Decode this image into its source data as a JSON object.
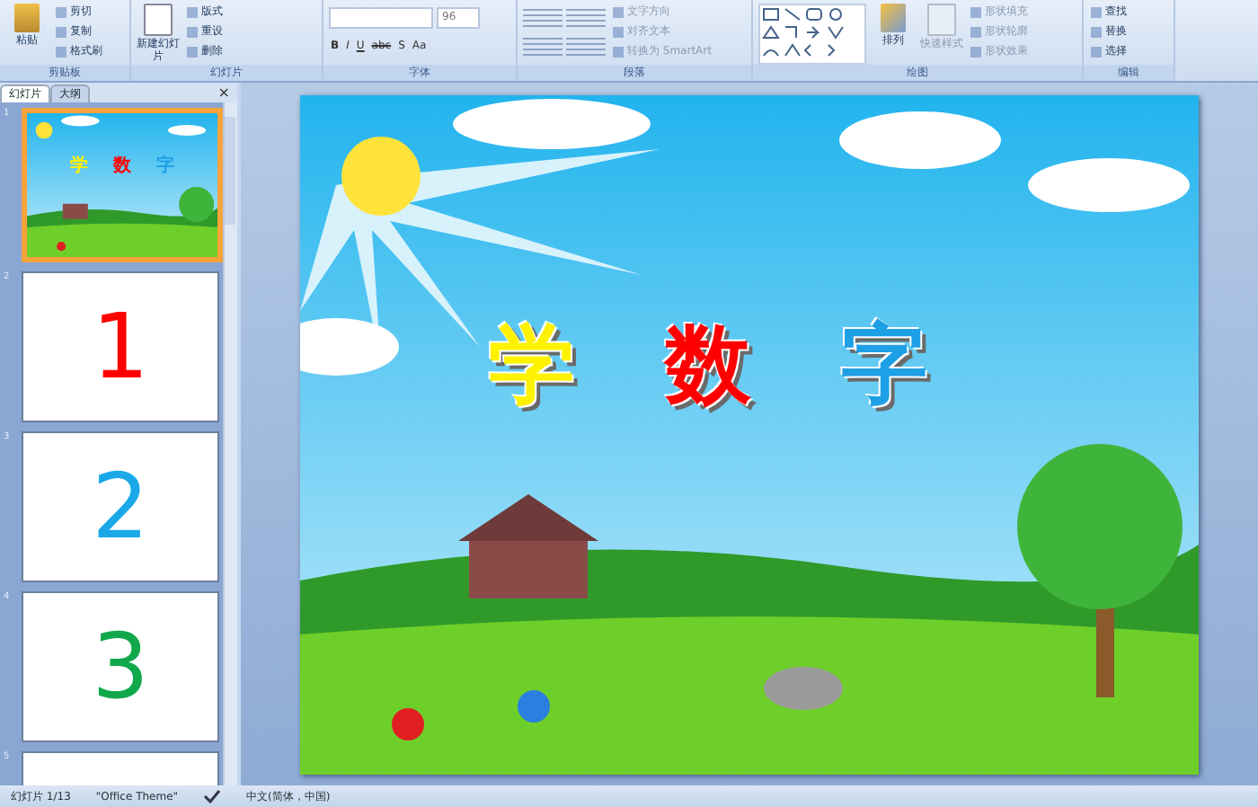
{
  "ribbon": {
    "groups": [
      {
        "kind": "clipboard",
        "label": "剪贴板",
        "big": "粘贴",
        "items": [
          "剪切",
          "复制",
          "格式刷"
        ]
      },
      {
        "kind": "slides",
        "label": "幻灯片",
        "big": "新建幻灯片",
        "items": [
          "版式",
          "重设",
          "删除"
        ]
      },
      {
        "kind": "font",
        "label": "字体",
        "size": "96",
        "buttons": [
          "B",
          "I",
          "U",
          "abc",
          "S",
          "Aa"
        ]
      },
      {
        "kind": "paragraph",
        "label": "段落",
        "items": [
          "文字方向",
          "对齐文本",
          "转换为 SmartArt"
        ]
      },
      {
        "kind": "drawing",
        "label": "绘图",
        "big": "排列",
        "big2": "快速样式",
        "items": [
          "形状填充",
          "形状轮廓",
          "形状效果"
        ]
      },
      {
        "kind": "editing",
        "label": "编辑",
        "items": [
          "查找",
          "替换",
          "选择"
        ]
      }
    ]
  },
  "pane": {
    "tabs": [
      {
        "label": "幻灯片",
        "selected": true
      },
      {
        "label": "大纲",
        "selected": false
      }
    ],
    "close": "×"
  },
  "slides": [
    {
      "number": "1",
      "selected": true,
      "kind": "title",
      "title": [
        {
          "text": "学",
          "color": "#fff200"
        },
        {
          "text": "数",
          "color": "#ff0000"
        },
        {
          "text": "字",
          "color": "#1ea0e6"
        }
      ]
    },
    {
      "number": "2",
      "selected": false,
      "kind": "digit",
      "text": "1",
      "color": "#ff0000"
    },
    {
      "number": "3",
      "selected": false,
      "kind": "digit",
      "text": "2",
      "color": "#1aa8e8"
    },
    {
      "number": "4",
      "selected": false,
      "kind": "digit",
      "text": "3",
      "color": "#10a84a"
    },
    {
      "number": "5",
      "selected": false,
      "kind": "blank"
    }
  ],
  "current_slide": {
    "kind": "picture",
    "title": [
      {
        "text": "学",
        "color": "#fff200"
      },
      {
        "text": "数",
        "color": "#ff0000"
      },
      {
        "text": "字",
        "color": "#1ea0e6"
      }
    ]
  },
  "status_bar": {
    "slide": "幻灯片 1/13",
    "theme": "\"Office Theme\"",
    "language": "中文(简体，中国)"
  }
}
